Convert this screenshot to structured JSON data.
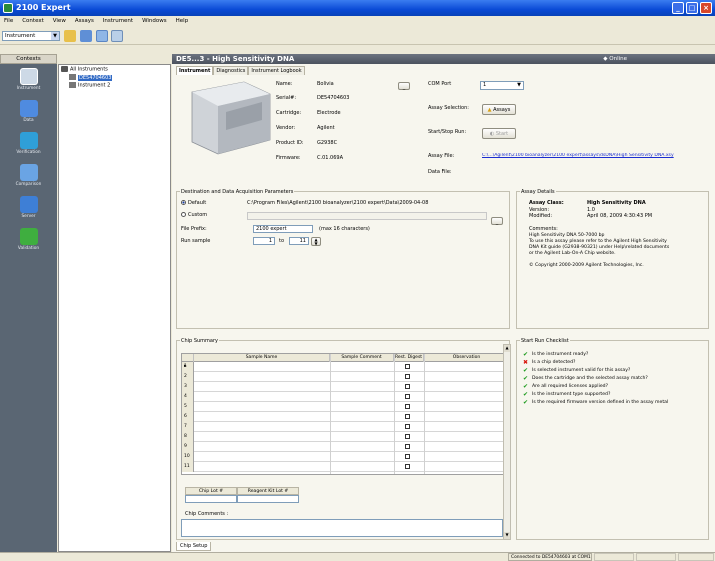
{
  "window": {
    "title": "2100 Expert"
  },
  "menu": [
    "File",
    "Context",
    "View",
    "Assays",
    "Instrument",
    "Windows",
    "Help"
  ],
  "toolbar": {
    "context": "Instrument"
  },
  "contexts_label": "Contexts",
  "nav": [
    {
      "label": "Instrument",
      "icon": "instrument-icon",
      "color": "#cdd9e6"
    },
    {
      "label": "Data",
      "icon": "data-icon",
      "color": "#4f8be0"
    },
    {
      "label": "Verification",
      "icon": "verification-icon",
      "color": "#2f9fd8"
    },
    {
      "label": "Comparison",
      "icon": "comparison-icon",
      "color": "#6aa4e4"
    },
    {
      "label": "Server",
      "icon": "server-icon",
      "color": "#3e7fd6"
    },
    {
      "label": "Validation",
      "icon": "validation-icon",
      "color": "#3fae3f"
    }
  ],
  "tree": {
    "root": "All Instruments",
    "items": [
      "DE54704603",
      "Instrument 2"
    ]
  },
  "header": {
    "title": "DE5...3 - High Sensitivity DNA",
    "status": "Online"
  },
  "tabs": [
    "Instrument",
    "Diagnostics",
    "Instrument Logbook"
  ],
  "instrument": {
    "fields": [
      {
        "label": "Name:",
        "value": "Bolivia"
      },
      {
        "label": "Serial#:",
        "value": "DE54704603"
      },
      {
        "label": "Cartridge:",
        "value": "Electrode"
      },
      {
        "label": "Vendor:",
        "value": "Agilent"
      },
      {
        "label": "Product ID:",
        "value": "G2938C"
      },
      {
        "label": "Firmware:",
        "value": "C.01.069A"
      }
    ],
    "com_port_label": "COM Port",
    "com_port_value": "1",
    "assay_selection_label": "Assay Selection:",
    "assays_button": "Assays",
    "start_stop_label": "Start/Stop Run:",
    "start_button": "Start",
    "assay_file_label": "Assay File:",
    "assay_file_value": "C:\\...\\Agilent\\2100 bioanalyzer\\2100 expert\\assays\\dsDNA\\High Sensitivity DNA.xsy",
    "data_file_label": "Data File:"
  },
  "destination": {
    "title": "Destination and Data Acquisition Parameters",
    "default_label": "Default",
    "default_path": "C:\\Program Files\\Agilent\\2100 bioanalyzer\\2100 expert\\Data\\2009-04-08",
    "custom_label": "Custom",
    "prefix_label": "File Prefix:",
    "prefix_value": "2100 expert",
    "prefix_hint": "(max 16 characters)",
    "run_label": "Run sample",
    "run_from": "1",
    "run_to_label": "to",
    "run_to": "11"
  },
  "assay_details": {
    "title": "Assay Details",
    "class_label": "Assay Class:",
    "class_value": "High Sensitivity DNA",
    "version_label": "Version:",
    "version_value": "1.0",
    "modified_label": "Modified:",
    "modified_value": "April 08, 2009 4:30:43 PM",
    "comments_label": "Comments:",
    "comments": [
      "High Sensitivity DNA 50-7000 bp",
      "To use this assay please refer to the Agilent High Sensitivity",
      "DNA Kit guide (G2938-90321) under Help\\related documents",
      "or the Agilent Lab-On-A Chip website."
    ],
    "copyright": "© Copyright 2000-2009 Agilent Technologies, Inc."
  },
  "chip_summary": {
    "title": "Chip Summary",
    "columns": [
      "Sample Name",
      "Sample Comment",
      "Rest. Digest",
      "Observation"
    ],
    "rows": [
      "1",
      "2",
      "3",
      "4",
      "5",
      "6",
      "7",
      "8",
      "9",
      "10",
      "11"
    ],
    "chip_lot_label": "Chip Lot #",
    "reagent_lot_label": "Reagent Kit Lot #",
    "comments_label": "Chip Comments :"
  },
  "checklist": {
    "title": "Start Run Checklist",
    "items": [
      {
        "text": "Is the instrument ready?",
        "ok": true
      },
      {
        "text": "Is a chip detected?",
        "ok": false
      },
      {
        "text": "Is selected instrument valid for this assay?",
        "ok": true
      },
      {
        "text": "Does the cartridge and the selected assay match?",
        "ok": true
      },
      {
        "text": "Are all required licenses applied?",
        "ok": true
      },
      {
        "text": "Is the instrument type supported?",
        "ok": true
      },
      {
        "text": "Is the required firmware version defined in the assay metal",
        "ok": true
      }
    ]
  },
  "bottom_tab": "Chip Setup",
  "status": {
    "text": "Connected to DE54704603 at COM1"
  }
}
